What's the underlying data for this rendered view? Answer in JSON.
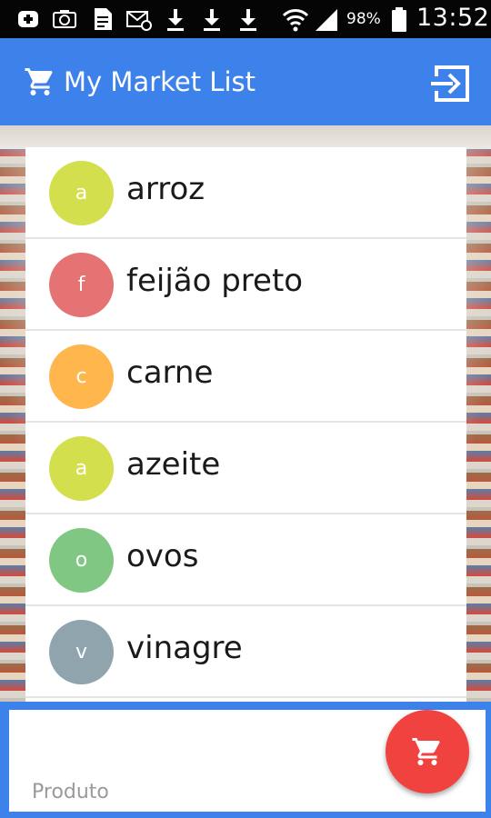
{
  "status_bar": {
    "icons": [
      "add-notification-icon",
      "camera-icon",
      "document-icon",
      "email-icon",
      "download-icon",
      "download-icon",
      "download-icon",
      "wifi-icon",
      "signal-icon",
      "battery-icon"
    ],
    "battery_percent": "98%",
    "time": "13:52"
  },
  "app_bar": {
    "title": "My Market List",
    "logo_icon": "shopping-cart-icon",
    "action_icon": "logout-icon",
    "color": "#3d81ea"
  },
  "items": [
    {
      "initial": "a",
      "label": "arroz",
      "color": "#d4df4e"
    },
    {
      "initial": "f",
      "label": "feijão preto",
      "color": "#e57373"
    },
    {
      "initial": "c",
      "label": "carne",
      "color": "#ffb74d"
    },
    {
      "initial": "a",
      "label": "azeite",
      "color": "#d4df4e"
    },
    {
      "initial": "o",
      "label": "ovos",
      "color": "#81c784"
    },
    {
      "initial": "v",
      "label": "vinagre",
      "color": "#90a4ae"
    }
  ],
  "bottom": {
    "input_value": "",
    "input_placeholder": "Produto",
    "add_button_icon": "add-to-cart-icon",
    "add_button_color": "#f0423f"
  }
}
